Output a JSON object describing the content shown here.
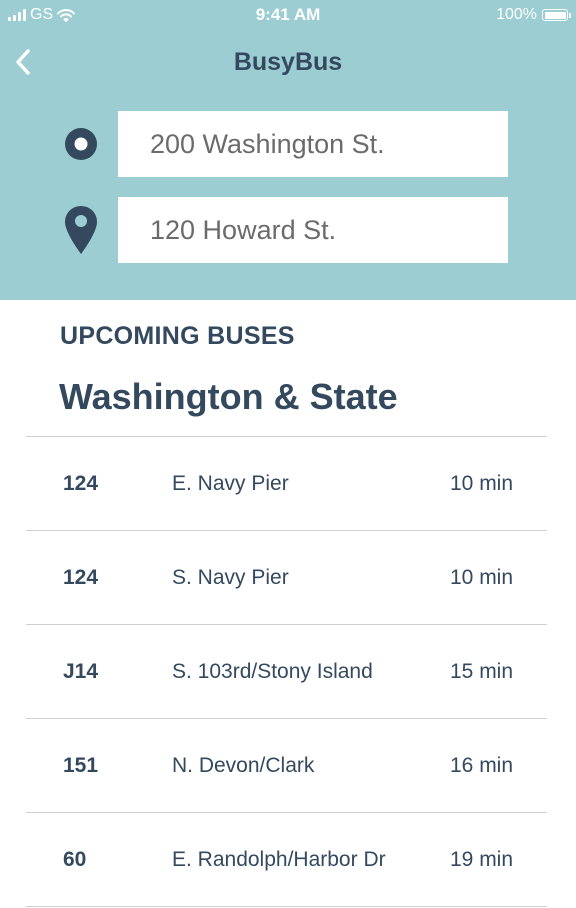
{
  "status_bar": {
    "carrier": "GS",
    "time": "9:41 AM",
    "battery": "100%",
    "battery_level": 1.0
  },
  "header": {
    "title": "BusyBus",
    "back_icon": "chevron-left-icon",
    "origin": {
      "icon": "origin-dot-icon",
      "value": "200 Washington St."
    },
    "destination": {
      "icon": "map-pin-icon",
      "value": "120 Howard St."
    }
  },
  "upcoming": {
    "section_label": "UPCOMING BUSES",
    "stop_name": "Washington & State",
    "buses": [
      {
        "route": "124",
        "destination": "E. Navy Pier",
        "eta": "10 min"
      },
      {
        "route": "124",
        "destination": "S. Navy Pier",
        "eta": "10 min"
      },
      {
        "route": "J14",
        "destination": "S. 103rd/Stony Island",
        "eta": "15 min"
      },
      {
        "route": "151",
        "destination": "N. Devon/Clark",
        "eta": "16 min"
      },
      {
        "route": "60",
        "destination": "E. Randolph/Harbor Dr",
        "eta": "19 min"
      }
    ]
  },
  "colors": {
    "header_bg": "#9ccdd3",
    "primary_text": "#34495e",
    "divider": "#d0d0d0",
    "input_text": "#6b6b6b"
  }
}
